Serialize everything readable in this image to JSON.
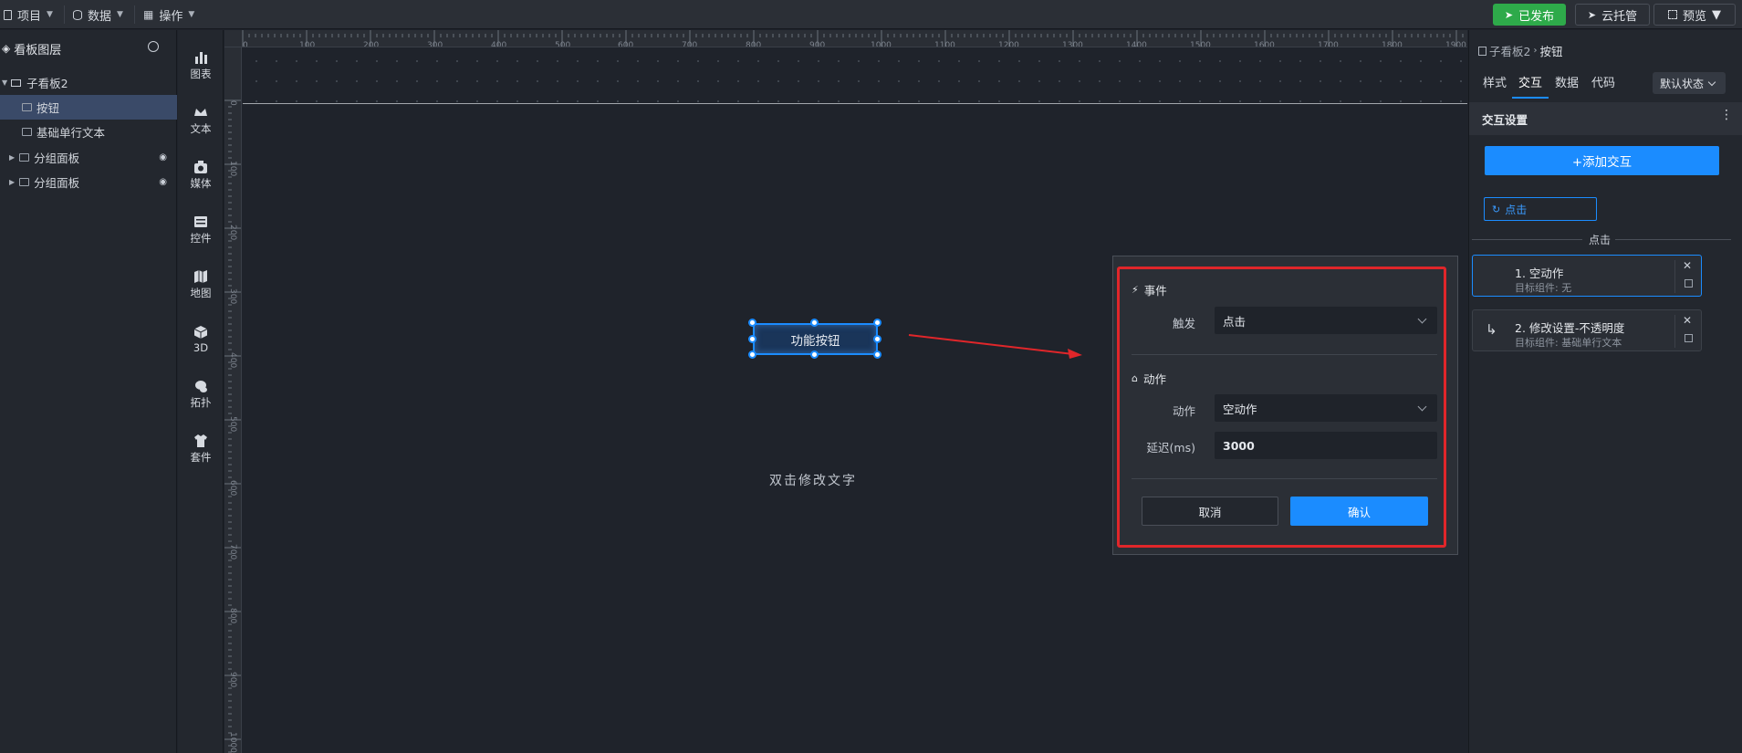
{
  "topbar": {
    "menu_project": "项目",
    "menu_data": "数据",
    "menu_ops": "操作",
    "published_label": "已发布",
    "cloud_label": "云托管",
    "preview_label": "预览",
    "published_color": "#2eaa4a"
  },
  "layers": {
    "title": "看板图层",
    "items": [
      {
        "label": "子看板2"
      },
      {
        "label": "按钮"
      },
      {
        "label": "基础单行文本"
      },
      {
        "label": "分组面板"
      },
      {
        "label": "分组面板"
      }
    ]
  },
  "components": [
    {
      "label": "图表",
      "icon": "bar-chart-icon"
    },
    {
      "label": "文本",
      "icon": "text-crown-icon"
    },
    {
      "label": "媒体",
      "icon": "media-icon"
    },
    {
      "label": "控件",
      "icon": "control-icon"
    },
    {
      "label": "地图",
      "icon": "map-icon"
    },
    {
      "label": "3D",
      "icon": "cube-icon"
    },
    {
      "label": "拓扑",
      "icon": "topology-icon"
    },
    {
      "label": "套件",
      "icon": "shirt-icon"
    }
  ],
  "ruler": {
    "h_ticks": [
      "0",
      "100",
      "200",
      "300",
      "400",
      "500",
      "600",
      "700",
      "800",
      "900",
      "1000",
      "1100",
      "1200",
      "1300",
      "1400",
      "1500",
      "1600",
      "1700",
      "1800",
      "1900"
    ],
    "v_ticks": [
      "0",
      "100",
      "200",
      "300",
      "400",
      "500",
      "600",
      "700",
      "800",
      "900",
      "1000"
    ]
  },
  "canvas": {
    "button_text": "功能按钮",
    "dbl_text": "双击修改文字"
  },
  "dialog": {
    "event_title": "事件",
    "trigger_label": "触发",
    "trigger_value": "点击",
    "action_title": "动作",
    "action_label": "动作",
    "action_value": "空动作",
    "delay_label": "延迟(ms)",
    "delay_value": "3000",
    "cancel_label": "取消",
    "confirm_label": "确认",
    "accent": "#1b8cff",
    "highlight": "#e0262a"
  },
  "rpanel": {
    "crumb_parent": "子看板2",
    "crumb_current": "按钮",
    "tabs": [
      "样式",
      "交互",
      "数据",
      "代码"
    ],
    "state_select": "默认状态",
    "section_title": "交互设置",
    "add_label": "+添加交互",
    "trigger_chip": "点击",
    "divider_label": "点击",
    "actions": [
      {
        "title": "1. 空动作",
        "sub": "目标组件: 无"
      },
      {
        "title": "2. 修改设置-不透明度",
        "sub": "目标组件: 基础单行文本"
      }
    ]
  }
}
